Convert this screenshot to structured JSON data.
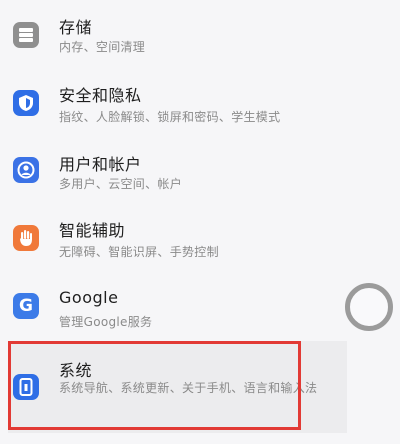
{
  "settings_list": {
    "items": [
      {
        "id": "storage",
        "icon": "storage-icon",
        "title": "存储",
        "subtitle": "内存、空间清理",
        "icon_color": "#8f8f8f"
      },
      {
        "id": "security-privacy",
        "icon": "shield-icon",
        "title": "安全和隐私",
        "subtitle": "指纹、人脸解锁、锁屏和密码、学生模式",
        "icon_color": "#2f6ee6"
      },
      {
        "id": "users-accounts",
        "icon": "user-icon",
        "title": "用户和帐户",
        "subtitle": "多用户、云空间、帐户",
        "icon_color": "#3b72e6"
      },
      {
        "id": "accessibility",
        "icon": "hand-icon",
        "title": "智能辅助",
        "subtitle": "无障碍、智能识屏、手势控制",
        "icon_color": "#f0793a"
      },
      {
        "id": "google",
        "icon": "google-g-icon",
        "title": "Google",
        "subtitle": "管理Google服务",
        "icon_color": "#3c7be8"
      },
      {
        "id": "system",
        "icon": "phone-icon",
        "title": "系统",
        "subtitle": "系统导航、系统更新、关于手机、语言和输入法",
        "icon_color": "#2f6ee6"
      }
    ]
  },
  "floating_button": {
    "icon": "assistive-touch-icon"
  },
  "highlight": {
    "target": "system",
    "color": "#e23a35"
  }
}
